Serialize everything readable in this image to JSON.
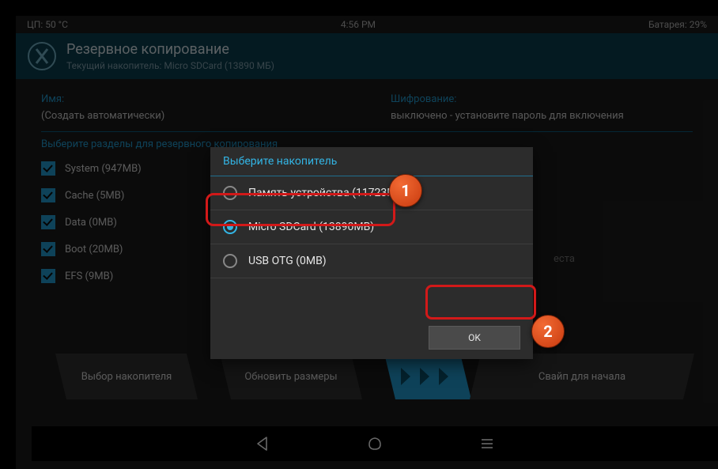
{
  "statusbar": {
    "cpu": "ЦП: 50 °C",
    "time": "4:56 PM",
    "battery": "Батарея: 29%"
  },
  "header": {
    "title": "Резервное копирование",
    "subtitle": "Текущий накопитель: Micro SDCard (13890 МБ)"
  },
  "fields": {
    "name_label": "Имя:",
    "name_value": "(Создать автоматически)",
    "encryption_label": "Шифрование:",
    "encryption_value": "выключено - установите пароль для включения"
  },
  "partitions_heading": "Выберите разделы для резервного копирования",
  "partitions": [
    {
      "label": "System (947MB)"
    },
    {
      "label": "Cache (5MB)"
    },
    {
      "label": "Data (0MB)"
    },
    {
      "label": "Boot (20MB)"
    },
    {
      "label": "EFS (9MB)"
    }
  ],
  "free_space_hint": "еста",
  "buttons": {
    "storage": "Выбор накопителя",
    "refresh": "Обновить размеры",
    "swipe": "Свайп для начала"
  },
  "dialog": {
    "title": "Выберите накопитель",
    "options": [
      {
        "label": "Память устройства (11723MB)",
        "selected": false
      },
      {
        "label": "Micro SDCard (13890MB)",
        "selected": true
      },
      {
        "label": "USB OTG (0MB)",
        "selected": false
      }
    ],
    "ok": "OK"
  },
  "steps": {
    "one": "1",
    "two": "2"
  }
}
